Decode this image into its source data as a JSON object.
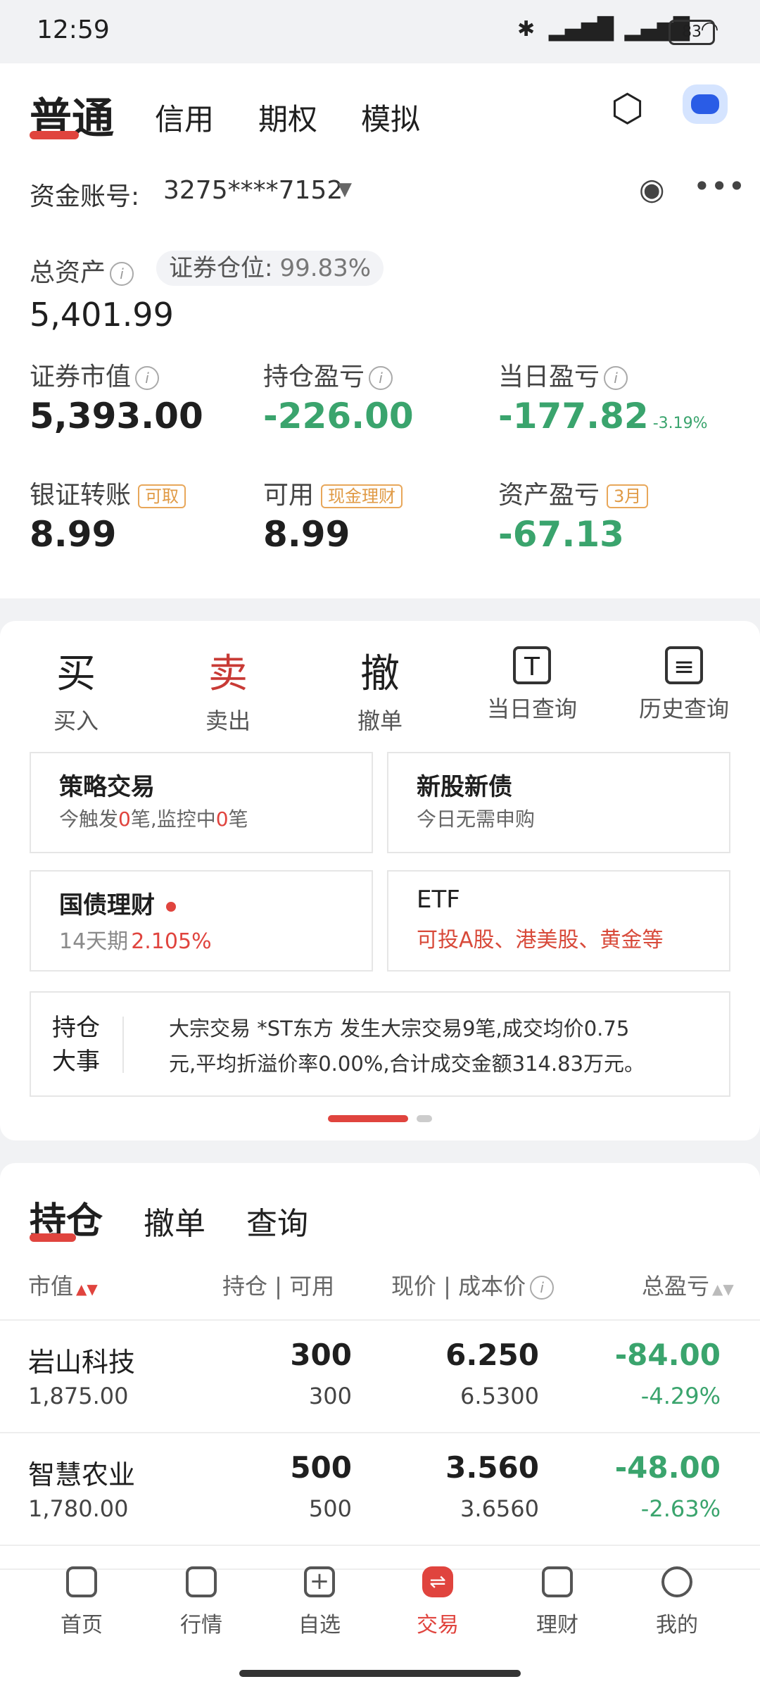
{
  "status_bar": {
    "time": "12:59",
    "battery": "83"
  },
  "top_tabs": [
    "普通",
    "信用",
    "期权",
    "模拟"
  ],
  "account": {
    "label": "资金账号:",
    "number": "3275****7152"
  },
  "summary": {
    "total_assets_label": "总资产",
    "total_assets": "5,401.99",
    "position_ratio_label": "证券仓位:",
    "position_ratio": "99.83%",
    "market_value_label": "证券市值",
    "market_value": "5,393.00",
    "holding_pl_label": "持仓盈亏",
    "holding_pl": "-226.00",
    "daily_pl_label": "当日盈亏",
    "daily_pl": "-177.82",
    "daily_pl_pct": "-3.19%",
    "bank_transfer_label": "银证转账",
    "bank_transfer_tag": "可取",
    "bank_transfer": "8.99",
    "available_label": "可用",
    "available_tag": "现金理财",
    "available": "8.99",
    "asset_pl_label": "资产盈亏",
    "asset_pl_tag": "3月",
    "asset_pl": "-67.13"
  },
  "actions": [
    {
      "glyph": "买",
      "label": "买入"
    },
    {
      "glyph": "卖",
      "label": "卖出"
    },
    {
      "glyph": "撤",
      "label": "撤单"
    },
    {
      "glyph": "T",
      "label": "当日查询"
    },
    {
      "glyph": "≡",
      "label": "历史查询"
    }
  ],
  "features": {
    "strategy": {
      "title": "策略交易",
      "sub_a": "今触发",
      "sub_n1": "0",
      "sub_b": "笔,监控中",
      "sub_n2": "0",
      "sub_c": "笔"
    },
    "ipo": {
      "title": "新股新债",
      "sub": "今日无需申购"
    },
    "bond": {
      "title": "国债理财",
      "sub_period": "14天期",
      "sub_rate": "2.105%"
    },
    "etf": {
      "title": "ETF",
      "sub": "可投A股、港美股、黄金等"
    }
  },
  "news": {
    "tag_line1": "持仓",
    "tag_line2": "大事",
    "text_line1": "大宗交易 *ST东方 发生大宗交易9笔,成交均价0.75",
    "text_line2": "元,平均折溢价率0.00%,合计成交金额314.83万元。"
  },
  "holdings_tabs": [
    "持仓",
    "撤单",
    "查询"
  ],
  "table_headers": {
    "col1": "市值",
    "col2": "持仓 | 可用",
    "col3": "现价 | 成本价",
    "col4": "总盈亏"
  },
  "holdings": [
    {
      "name": "岩山科技",
      "value": "1,875.00",
      "qty": "300",
      "avail": "300",
      "price": "6.250",
      "cost": "6.5300",
      "pl": "-84.00",
      "pl_pct": "-4.29%"
    },
    {
      "name": "智慧农业",
      "value": "1,780.00",
      "qty": "500",
      "avail": "500",
      "price": "3.560",
      "cost": "3.6560",
      "pl": "-48.00",
      "pl_pct": "-2.63%"
    }
  ],
  "bottom_nav": [
    "首页",
    "行情",
    "自选",
    "交易",
    "理财",
    "我的"
  ],
  "colors": {
    "up": "#e0443e",
    "down": "#3aa46d",
    "accent": "#e0443e"
  }
}
